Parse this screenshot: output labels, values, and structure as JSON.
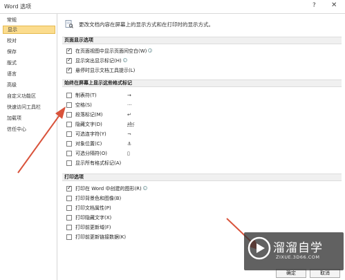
{
  "window": {
    "title": "Word 选项",
    "help_glyph": "?",
    "close_glyph": "✕"
  },
  "sidebar": {
    "items": [
      {
        "label": "常规"
      },
      {
        "label": "显示"
      },
      {
        "label": "校对"
      },
      {
        "label": "保存"
      },
      {
        "label": "版式"
      },
      {
        "label": "语言"
      },
      {
        "label": "高级"
      },
      {
        "label": "自定义功能区"
      },
      {
        "label": "快速访问工具栏"
      },
      {
        "label": "加载项"
      },
      {
        "label": "信任中心"
      }
    ],
    "active_index": 1
  },
  "main": {
    "intro": "更改文档内容在屏幕上的显示方式和在打印时的显示方式。",
    "page_display": {
      "header": "页面显示选项",
      "options": [
        {
          "label": "在页面视图中显示页面间空白(W)",
          "checked": true,
          "info": "i"
        },
        {
          "label": "显示突出显示标记(H)",
          "checked": true,
          "info": "i"
        },
        {
          "label": "悬停时显示文档工具提示(L)",
          "checked": true
        }
      ]
    },
    "format_marks": {
      "header": "始终在屏幕上显示这些格式标记",
      "options": [
        {
          "label": "制表符(T)",
          "checked": false,
          "symbol": "→"
        },
        {
          "label": "空格(S)",
          "checked": false,
          "symbol": "···"
        },
        {
          "label": "段落标记(M)",
          "checked": false,
          "symbol": "↵"
        },
        {
          "label": "隐藏文字(D)",
          "checked": false,
          "symbol": "abc"
        },
        {
          "label": "可选连字符(Y)",
          "checked": false,
          "symbol": "¬"
        },
        {
          "label": "对象位置(C)",
          "checked": false,
          "symbol": "⚓"
        },
        {
          "label": "可选分隔符(O)",
          "checked": false,
          "symbol": "▯"
        },
        {
          "label": "显示所有格式标记(A)",
          "checked": false
        }
      ]
    },
    "print": {
      "header": "打印选项",
      "options": [
        {
          "label": "打印在 Word 中创建的图形(R)",
          "checked": true,
          "info": "i"
        },
        {
          "label": "打印背景色和图像(B)",
          "checked": false
        },
        {
          "label": "打印文档属性(P)",
          "checked": false
        },
        {
          "label": "打印隐藏文字(X)",
          "checked": false
        },
        {
          "label": "打印前更新域(F)",
          "checked": false
        },
        {
          "label": "打印前更新链接数据(K)",
          "checked": false
        }
      ]
    }
  },
  "footer": {
    "ok_label": "确定",
    "cancel_label": "取消"
  },
  "watermark": {
    "name": "溜溜自学",
    "url": "ZIXUE.3D66.COM"
  },
  "colors": {
    "accent_selected": "#fbdc8e",
    "arrow": "#d9533b"
  }
}
